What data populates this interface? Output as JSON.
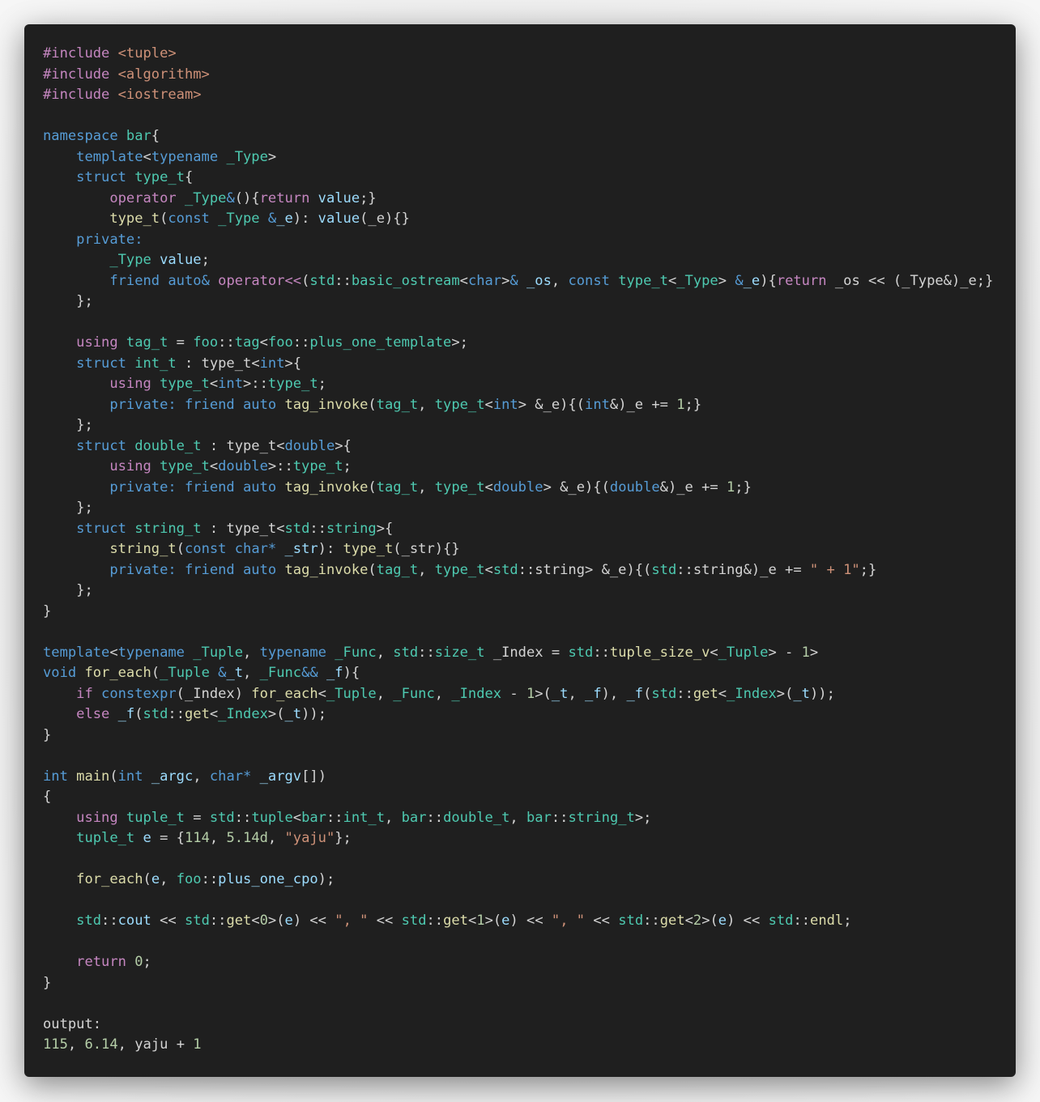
{
  "colors": {
    "background": "#1f1f1f",
    "default": "#d4d4d4",
    "preprocessor": "#c586c0",
    "include_path": "#ce9178",
    "keyword_blue": "#569cd6",
    "keyword_purple": "#c586c0",
    "type": "#4ec9b0",
    "function": "#dcdcaa",
    "variable": "#9cdcfe",
    "string": "#ce9178",
    "number": "#b5cea8"
  },
  "code_lines": [
    [
      [
        "#include ",
        "preprocessor"
      ],
      [
        "<tuple>",
        "include_path"
      ]
    ],
    [
      [
        "#include ",
        "preprocessor"
      ],
      [
        "<algorithm>",
        "include_path"
      ]
    ],
    [
      [
        "#include ",
        "preprocessor"
      ],
      [
        "<iostream>",
        "include_path"
      ]
    ],
    [],
    [
      [
        "namespace ",
        "keyword_blue"
      ],
      [
        "bar",
        "type"
      ],
      [
        "{",
        "default"
      ]
    ],
    [
      [
        "    ",
        "default"
      ],
      [
        "template",
        "keyword_blue"
      ],
      [
        "<",
        "default"
      ],
      [
        "typename ",
        "keyword_blue"
      ],
      [
        "_Type",
        "type"
      ],
      [
        ">",
        "default"
      ]
    ],
    [
      [
        "    ",
        "default"
      ],
      [
        "struct ",
        "keyword_blue"
      ],
      [
        "type_t",
        "type"
      ],
      [
        "{",
        "default"
      ]
    ],
    [
      [
        "        ",
        "default"
      ],
      [
        "operator ",
        "keyword_purple"
      ],
      [
        "_Type",
        "type"
      ],
      [
        "&",
        "keyword_blue"
      ],
      [
        "(){",
        "default"
      ],
      [
        "return ",
        "keyword_purple"
      ],
      [
        "value",
        "variable"
      ],
      [
        ";}",
        "default"
      ]
    ],
    [
      [
        "        ",
        "default"
      ],
      [
        "type_t",
        "function"
      ],
      [
        "(",
        "default"
      ],
      [
        "const ",
        "keyword_blue"
      ],
      [
        "_Type ",
        "type"
      ],
      [
        "&",
        "keyword_blue"
      ],
      [
        "_e",
        "variable"
      ],
      [
        "): ",
        "default"
      ],
      [
        "value",
        "variable"
      ],
      [
        "(_e){}",
        "default"
      ]
    ],
    [
      [
        "    ",
        "default"
      ],
      [
        "private:",
        "keyword_blue"
      ]
    ],
    [
      [
        "        ",
        "default"
      ],
      [
        "_Type ",
        "type"
      ],
      [
        "value",
        "variable"
      ],
      [
        ";",
        "default"
      ]
    ],
    [
      [
        "        ",
        "default"
      ],
      [
        "friend ",
        "keyword_blue"
      ],
      [
        "auto",
        "keyword_blue"
      ],
      [
        "& ",
        "keyword_blue"
      ],
      [
        "operator<<",
        "keyword_purple"
      ],
      [
        "(",
        "default"
      ],
      [
        "std",
        "type"
      ],
      [
        "::",
        "default"
      ],
      [
        "basic_ostream",
        "type"
      ],
      [
        "<",
        "default"
      ],
      [
        "char",
        "keyword_blue"
      ],
      [
        ">",
        "default"
      ],
      [
        "& ",
        "keyword_blue"
      ],
      [
        "_os",
        "variable"
      ],
      [
        ", ",
        "default"
      ],
      [
        "const ",
        "keyword_blue"
      ],
      [
        "type_t",
        "type"
      ],
      [
        "<",
        "default"
      ],
      [
        "_Type",
        "type"
      ],
      [
        "> ",
        "default"
      ],
      [
        "&",
        "keyword_blue"
      ],
      [
        "_e",
        "variable"
      ],
      [
        ")",
        "default"
      ],
      [
        "{",
        "default"
      ],
      [
        "return ",
        "keyword_purple"
      ],
      [
        "_os << (_Type&)_e;}",
        "default"
      ]
    ],
    [
      [
        "    ",
        "default"
      ],
      [
        "};",
        "default"
      ]
    ],
    [],
    [
      [
        "    ",
        "default"
      ],
      [
        "using ",
        "keyword_purple"
      ],
      [
        "tag_t",
        "type"
      ],
      [
        " = ",
        "default"
      ],
      [
        "foo",
        "type"
      ],
      [
        "::",
        "default"
      ],
      [
        "tag",
        "type"
      ],
      [
        "<",
        "default"
      ],
      [
        "foo",
        "type"
      ],
      [
        "::",
        "default"
      ],
      [
        "plus_one_template",
        "type"
      ],
      [
        ">;",
        "default"
      ]
    ],
    [
      [
        "    ",
        "default"
      ],
      [
        "struct ",
        "keyword_blue"
      ],
      [
        "int_t",
        "type"
      ],
      [
        " : ",
        "default"
      ],
      [
        "type_t",
        "default"
      ],
      [
        "<",
        "default"
      ],
      [
        "int",
        "keyword_blue"
      ],
      [
        ">{",
        "default"
      ]
    ],
    [
      [
        "        ",
        "default"
      ],
      [
        "using ",
        "keyword_purple"
      ],
      [
        "type_t",
        "type"
      ],
      [
        "<",
        "default"
      ],
      [
        "int",
        "keyword_blue"
      ],
      [
        ">::",
        "default"
      ],
      [
        "type_t",
        "type"
      ],
      [
        ";",
        "default"
      ]
    ],
    [
      [
        "        ",
        "default"
      ],
      [
        "private: ",
        "keyword_blue"
      ],
      [
        "friend ",
        "keyword_blue"
      ],
      [
        "auto ",
        "keyword_blue"
      ],
      [
        "tag_invoke",
        "function"
      ],
      [
        "(",
        "default"
      ],
      [
        "tag_t",
        "type"
      ],
      [
        ", ",
        "default"
      ],
      [
        "type_t",
        "type"
      ],
      [
        "<",
        "default"
      ],
      [
        "int",
        "keyword_blue"
      ],
      [
        "> &_e){(",
        "default"
      ],
      [
        "int",
        "keyword_blue"
      ],
      [
        "&)_e += ",
        "default"
      ],
      [
        "1",
        "number"
      ],
      [
        ";}",
        "default"
      ]
    ],
    [
      [
        "    ",
        "default"
      ],
      [
        "};",
        "default"
      ]
    ],
    [
      [
        "    ",
        "default"
      ],
      [
        "struct ",
        "keyword_blue"
      ],
      [
        "double_t",
        "type"
      ],
      [
        " : ",
        "default"
      ],
      [
        "type_t",
        "default"
      ],
      [
        "<",
        "default"
      ],
      [
        "double",
        "keyword_blue"
      ],
      [
        ">{",
        "default"
      ]
    ],
    [
      [
        "        ",
        "default"
      ],
      [
        "using ",
        "keyword_purple"
      ],
      [
        "type_t",
        "type"
      ],
      [
        "<",
        "default"
      ],
      [
        "double",
        "keyword_blue"
      ],
      [
        ">::",
        "default"
      ],
      [
        "type_t",
        "type"
      ],
      [
        ";",
        "default"
      ]
    ],
    [
      [
        "        ",
        "default"
      ],
      [
        "private: ",
        "keyword_blue"
      ],
      [
        "friend ",
        "keyword_blue"
      ],
      [
        "auto ",
        "keyword_blue"
      ],
      [
        "tag_invoke",
        "function"
      ],
      [
        "(",
        "default"
      ],
      [
        "tag_t",
        "type"
      ],
      [
        ", ",
        "default"
      ],
      [
        "type_t",
        "type"
      ],
      [
        "<",
        "default"
      ],
      [
        "double",
        "keyword_blue"
      ],
      [
        "> &_e){(",
        "default"
      ],
      [
        "double",
        "keyword_blue"
      ],
      [
        "&)_e += ",
        "default"
      ],
      [
        "1",
        "number"
      ],
      [
        ";}",
        "default"
      ]
    ],
    [
      [
        "    ",
        "default"
      ],
      [
        "};",
        "default"
      ]
    ],
    [
      [
        "    ",
        "default"
      ],
      [
        "struct ",
        "keyword_blue"
      ],
      [
        "string_t",
        "type"
      ],
      [
        " : ",
        "default"
      ],
      [
        "type_t",
        "default"
      ],
      [
        "<",
        "default"
      ],
      [
        "std",
        "type"
      ],
      [
        "::",
        "default"
      ],
      [
        "string",
        "type"
      ],
      [
        ">{",
        "default"
      ]
    ],
    [
      [
        "        ",
        "default"
      ],
      [
        "string_t",
        "function"
      ],
      [
        "(",
        "default"
      ],
      [
        "const ",
        "keyword_blue"
      ],
      [
        "char",
        "keyword_blue"
      ],
      [
        "* ",
        "keyword_blue"
      ],
      [
        "_str",
        "variable"
      ],
      [
        "): ",
        "default"
      ],
      [
        "type_t",
        "function"
      ],
      [
        "(_str){}",
        "default"
      ]
    ],
    [
      [
        "        ",
        "default"
      ],
      [
        "private: ",
        "keyword_blue"
      ],
      [
        "friend ",
        "keyword_blue"
      ],
      [
        "auto ",
        "keyword_blue"
      ],
      [
        "tag_invoke",
        "function"
      ],
      [
        "(",
        "default"
      ],
      [
        "tag_t",
        "type"
      ],
      [
        ", ",
        "default"
      ],
      [
        "type_t",
        "type"
      ],
      [
        "<",
        "default"
      ],
      [
        "std",
        "type"
      ],
      [
        "::string> &_e){(",
        "default"
      ],
      [
        "std",
        "type"
      ],
      [
        "::string&)_e += ",
        "default"
      ],
      [
        "\" + 1\"",
        "string"
      ],
      [
        ";}",
        "default"
      ]
    ],
    [
      [
        "    ",
        "default"
      ],
      [
        "};",
        "default"
      ]
    ],
    [
      [
        "}",
        "default"
      ]
    ],
    [],
    [
      [
        "template",
        "keyword_blue"
      ],
      [
        "<",
        "default"
      ],
      [
        "typename ",
        "keyword_blue"
      ],
      [
        "_Tuple",
        "type"
      ],
      [
        ", ",
        "default"
      ],
      [
        "typename ",
        "keyword_blue"
      ],
      [
        "_Func",
        "type"
      ],
      [
        ", ",
        "default"
      ],
      [
        "std",
        "type"
      ],
      [
        "::",
        "default"
      ],
      [
        "size_t ",
        "type"
      ],
      [
        "_Index = ",
        "default"
      ],
      [
        "std",
        "type"
      ],
      [
        "::",
        "default"
      ],
      [
        "tuple_size_v",
        "function"
      ],
      [
        "<",
        "default"
      ],
      [
        "_Tuple",
        "type"
      ],
      [
        "> - ",
        "default"
      ],
      [
        "1",
        "number"
      ],
      [
        ">",
        "default"
      ]
    ],
    [
      [
        "void ",
        "keyword_blue"
      ],
      [
        "for_each",
        "function"
      ],
      [
        "(",
        "default"
      ],
      [
        "_Tuple ",
        "type"
      ],
      [
        "&",
        "keyword_blue"
      ],
      [
        "_t",
        "variable"
      ],
      [
        ", ",
        "default"
      ],
      [
        "_Func",
        "type"
      ],
      [
        "&& ",
        "keyword_blue"
      ],
      [
        "_f",
        "variable"
      ],
      [
        "){",
        "default"
      ]
    ],
    [
      [
        "    ",
        "default"
      ],
      [
        "if ",
        "keyword_purple"
      ],
      [
        "constexpr",
        "keyword_blue"
      ],
      [
        "(_Index) ",
        "default"
      ],
      [
        "for_each",
        "function"
      ],
      [
        "<",
        "default"
      ],
      [
        "_Tuple",
        "type"
      ],
      [
        ", ",
        "default"
      ],
      [
        "_Func",
        "type"
      ],
      [
        ", ",
        "default"
      ],
      [
        "_Index",
        "type"
      ],
      [
        " - ",
        "default"
      ],
      [
        "1",
        "number"
      ],
      [
        ">(",
        "default"
      ],
      [
        "_t",
        "variable"
      ],
      [
        ", ",
        "default"
      ],
      [
        "_f",
        "variable"
      ],
      [
        "), ",
        "default"
      ],
      [
        "_f",
        "variable"
      ],
      [
        "(",
        "default"
      ],
      [
        "std",
        "type"
      ],
      [
        "::",
        "default"
      ],
      [
        "get",
        "function"
      ],
      [
        "<",
        "default"
      ],
      [
        "_Index",
        "type"
      ],
      [
        ">(",
        "default"
      ],
      [
        "_t",
        "variable"
      ],
      [
        "));",
        "default"
      ]
    ],
    [
      [
        "    ",
        "default"
      ],
      [
        "else ",
        "keyword_purple"
      ],
      [
        "_f",
        "variable"
      ],
      [
        "(",
        "default"
      ],
      [
        "std",
        "type"
      ],
      [
        "::",
        "default"
      ],
      [
        "get",
        "function"
      ],
      [
        "<",
        "default"
      ],
      [
        "_Index",
        "type"
      ],
      [
        ">(",
        "default"
      ],
      [
        "_t",
        "variable"
      ],
      [
        "));",
        "default"
      ]
    ],
    [
      [
        "}",
        "default"
      ]
    ],
    [],
    [
      [
        "int ",
        "keyword_blue"
      ],
      [
        "main",
        "function"
      ],
      [
        "(",
        "default"
      ],
      [
        "int ",
        "keyword_blue"
      ],
      [
        "_argc",
        "variable"
      ],
      [
        ", ",
        "default"
      ],
      [
        "char",
        "keyword_blue"
      ],
      [
        "* ",
        "keyword_blue"
      ],
      [
        "_argv",
        "variable"
      ],
      [
        "[])",
        "default"
      ]
    ],
    [
      [
        "{",
        "default"
      ]
    ],
    [
      [
        "    ",
        "default"
      ],
      [
        "using ",
        "keyword_purple"
      ],
      [
        "tuple_t",
        "type"
      ],
      [
        " = ",
        "default"
      ],
      [
        "std",
        "type"
      ],
      [
        "::",
        "default"
      ],
      [
        "tuple",
        "type"
      ],
      [
        "<",
        "default"
      ],
      [
        "bar",
        "type"
      ],
      [
        "::",
        "default"
      ],
      [
        "int_t",
        "type"
      ],
      [
        ", ",
        "default"
      ],
      [
        "bar",
        "type"
      ],
      [
        "::",
        "default"
      ],
      [
        "double_t",
        "type"
      ],
      [
        ", ",
        "default"
      ],
      [
        "bar",
        "type"
      ],
      [
        "::",
        "default"
      ],
      [
        "string_t",
        "type"
      ],
      [
        ">;",
        "default"
      ]
    ],
    [
      [
        "    ",
        "default"
      ],
      [
        "tuple_t ",
        "type"
      ],
      [
        "e",
        "variable"
      ],
      [
        " = {",
        "default"
      ],
      [
        "114",
        "number"
      ],
      [
        ", ",
        "default"
      ],
      [
        "5.14d",
        "number"
      ],
      [
        ", ",
        "default"
      ],
      [
        "\"yaju\"",
        "string"
      ],
      [
        "};",
        "default"
      ]
    ],
    [],
    [
      [
        "    ",
        "default"
      ],
      [
        "for_each",
        "function"
      ],
      [
        "(",
        "default"
      ],
      [
        "e",
        "variable"
      ],
      [
        ", ",
        "default"
      ],
      [
        "foo",
        "type"
      ],
      [
        "::",
        "default"
      ],
      [
        "plus_one_cpo",
        "variable"
      ],
      [
        ");",
        "default"
      ]
    ],
    [],
    [
      [
        "    ",
        "default"
      ],
      [
        "std",
        "type"
      ],
      [
        "::",
        "default"
      ],
      [
        "cout",
        "variable"
      ],
      [
        " << ",
        "default"
      ],
      [
        "std",
        "type"
      ],
      [
        "::",
        "default"
      ],
      [
        "get",
        "function"
      ],
      [
        "<",
        "default"
      ],
      [
        "0",
        "number"
      ],
      [
        ">(",
        "default"
      ],
      [
        "e",
        "variable"
      ],
      [
        ") << ",
        "default"
      ],
      [
        "\", \"",
        "string"
      ],
      [
        " << ",
        "default"
      ],
      [
        "std",
        "type"
      ],
      [
        "::",
        "default"
      ],
      [
        "get",
        "function"
      ],
      [
        "<",
        "default"
      ],
      [
        "1",
        "number"
      ],
      [
        ">(",
        "default"
      ],
      [
        "e",
        "variable"
      ],
      [
        ") << ",
        "default"
      ],
      [
        "\", \"",
        "string"
      ],
      [
        " << ",
        "default"
      ],
      [
        "std",
        "type"
      ],
      [
        "::",
        "default"
      ],
      [
        "get",
        "function"
      ],
      [
        "<",
        "default"
      ],
      [
        "2",
        "number"
      ],
      [
        ">(",
        "default"
      ],
      [
        "e",
        "variable"
      ],
      [
        ") << ",
        "default"
      ],
      [
        "std",
        "type"
      ],
      [
        "::",
        "default"
      ],
      [
        "endl",
        "function"
      ],
      [
        ";",
        "default"
      ]
    ],
    [],
    [
      [
        "    ",
        "default"
      ],
      [
        "return ",
        "keyword_purple"
      ],
      [
        "0",
        "number"
      ],
      [
        ";",
        "default"
      ]
    ],
    [
      [
        "}",
        "default"
      ]
    ],
    [],
    [
      [
        "output:",
        "default"
      ]
    ],
    [
      [
        "115",
        "number"
      ],
      [
        ", ",
        "default"
      ],
      [
        "6.14",
        "number"
      ],
      [
        ", ",
        "default"
      ],
      [
        "yaju + ",
        "default"
      ],
      [
        "1",
        "number"
      ]
    ]
  ]
}
